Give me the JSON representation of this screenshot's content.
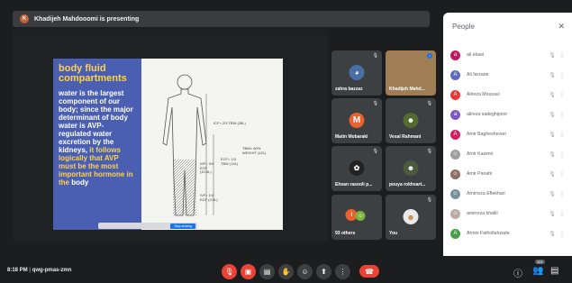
{
  "presenting_bar": {
    "icon_letter": "K",
    "text": "Khadijeh Mahdooomi is presenting"
  },
  "slide": {
    "title": "body fluid compartments",
    "body_white": "water is the largest component of our body; since the major determinant of body water is AVP-regulated water excretion by the kidneys,",
    "body_yellow": "it follows logically that AVP must be the most important hormone in the",
    "body_end": "body",
    "labels": {
      "icf": "ICF= 2/3 TBW (28L)",
      "tbw": "TBW= 60% WEIGHT (42L)",
      "isf": "ISF= 3/4 ECF (10.5L)",
      "ecf": "ECF= 1/3 TBW (14L)",
      "ipf": "IVF= 1/4 ECF (3.5L)"
    },
    "share_button": "Stop sharing"
  },
  "tiles": [
    {
      "name": "zahra bazzaz",
      "initial": "",
      "color": "#3c4043"
    },
    {
      "name": "Khadijeh Mahd...",
      "initial": "",
      "color": "#8a6b45"
    },
    {
      "name": "Matin Mobaraki",
      "initial": "M",
      "color": "#e8612f"
    },
    {
      "name": "Vesal Rahmani",
      "initial": "",
      "color": "#3c4043"
    },
    {
      "name": "Ehsan rasooli p...",
      "initial": "",
      "color": "#3c4043"
    },
    {
      "name": "pouya rokhsart...",
      "initial": "",
      "color": "#3c4043"
    },
    {
      "name": "93 others",
      "initial": "",
      "color": "#3c4043"
    },
    {
      "name": "You",
      "initial": "",
      "color": "#3c4043"
    }
  ],
  "people": {
    "header": "People",
    "list": [
      {
        "name": "ali ebaei",
        "initial": "a",
        "color": "#c2185b"
      },
      {
        "name": "Ali farzane",
        "initial": "A",
        "color": "#5c6bc0"
      },
      {
        "name": "Alireza Mousavi",
        "initial": "A",
        "color": "#e53935"
      },
      {
        "name": "alireza sadeghipoor",
        "initial": "a",
        "color": "#7e57c2"
      },
      {
        "name": "Amir Bagheshevan",
        "initial": "A",
        "color": "#d81b60"
      },
      {
        "name": "Amir Kazemi",
        "initial": "",
        "color": "#9e9e9e"
      },
      {
        "name": "Amir Panahi",
        "initial": "",
        "color": "#8d6e63"
      },
      {
        "name": "Amirreza Eftekhari",
        "initial": "",
        "color": "#78909c"
      },
      {
        "name": "amirreza khalili",
        "initial": "",
        "color": "#bcaaa4"
      },
      {
        "name": "Armin Fathollahzade",
        "initial": "A",
        "color": "#43a047"
      }
    ]
  },
  "bottom": {
    "time": "8:18 PM",
    "meeting_code": "qwg-pmas-zmn",
    "participant_count": "101"
  }
}
